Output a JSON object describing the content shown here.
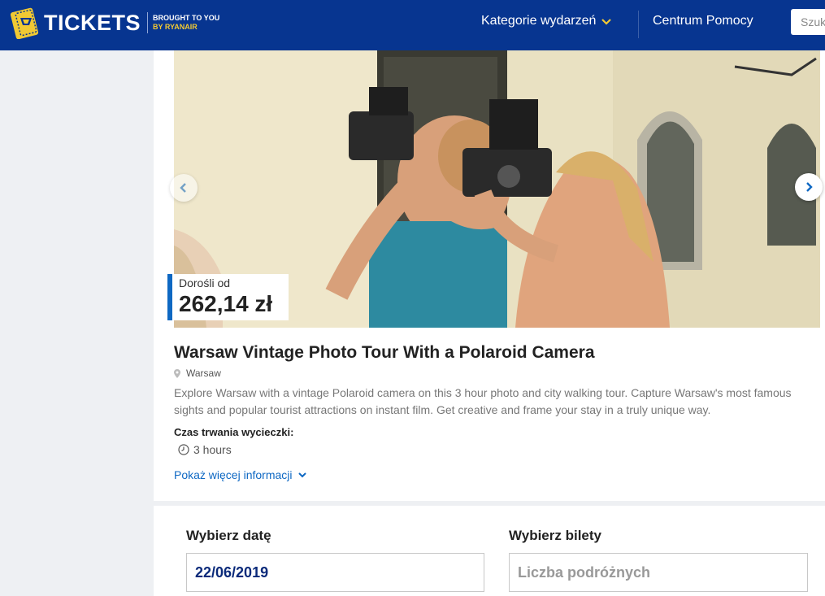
{
  "header": {
    "logo_text": "TICKETS",
    "logo_sub1": "BROUGHT TO YOU",
    "logo_sub2": "BY RYANAIR",
    "categories_label": "Kategorie wydarzeń",
    "help_label": "Centrum Pomocy",
    "search_placeholder": "Szukaj"
  },
  "colors": {
    "header_bg": "#073590",
    "accent_blue": "#0e68c3",
    "brand_yellow": "#f1c933"
  },
  "hero": {
    "price_label": "Dorośli od",
    "price_value": "262,14 zł"
  },
  "tour": {
    "title": "Warsaw Vintage Photo Tour With a Polaroid Camera",
    "location": "Warsaw",
    "description": "Explore Warsaw with a vintage Polaroid camera on this 3 hour photo and city walking tour. Capture Warsaw's most famous sights and popular tourist attractions on instant film. Get creative and frame your stay in a truly unique way.",
    "duration_heading": "Czas trwania wycieczki:",
    "duration_value": "3 hours",
    "more_info_label": "Pokaż więcej informacji"
  },
  "booking": {
    "date_heading": "Wybierz datę",
    "date_value": "22/06/2019",
    "tickets_heading": "Wybierz bilety",
    "tickets_placeholder": "Liczba podróżnych"
  }
}
